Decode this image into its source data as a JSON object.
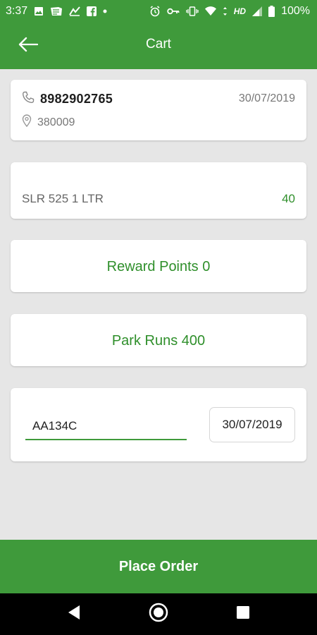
{
  "status_bar": {
    "time": "3:37",
    "network": "HD",
    "battery": "100%",
    "icons_left": [
      "image-icon",
      "news-icon",
      "chart-icon",
      "facebook-icon",
      "dot-icon"
    ],
    "icons_right": [
      "alarm-icon",
      "key-icon",
      "vibrate-icon",
      "wifi-icon",
      "data-arrows-icon",
      "signal-icon",
      "battery-icon"
    ]
  },
  "app_bar": {
    "title": "Cart",
    "back_icon": "arrow-left-icon"
  },
  "contact": {
    "phone": "8982902765",
    "pincode": "380009",
    "date": "30/07/2019",
    "phone_icon": "phone-icon",
    "pin_icon": "location-pin-icon"
  },
  "item": {
    "name": "SLR 525 1 LTR",
    "quantity": "40"
  },
  "reward": {
    "text": "Reward Points 0"
  },
  "park": {
    "text": "Park Runs 400"
  },
  "form": {
    "code_value": "AA134C",
    "date_value": "30/07/2019"
  },
  "footer": {
    "place_order_label": "Place Order"
  },
  "colors": {
    "primary": "#3f9a3b",
    "accent_text": "#2f8f2b",
    "background": "#e6e6e6"
  },
  "nav_bar": {
    "icons": [
      "back-triangle-icon",
      "home-circle-icon",
      "recents-square-icon"
    ]
  }
}
